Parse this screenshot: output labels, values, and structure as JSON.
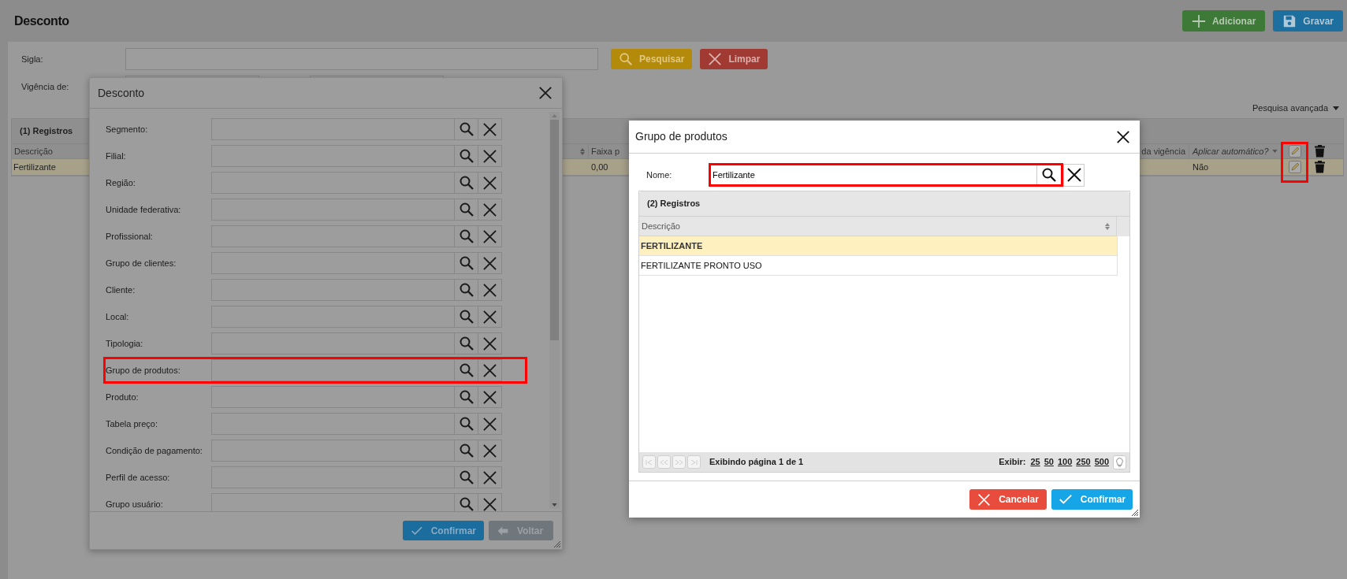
{
  "page": {
    "title": "Desconto",
    "buttons": [
      {
        "label": "Adicionar",
        "kind": "add"
      },
      {
        "label": "Gravar",
        "kind": "save"
      }
    ]
  },
  "filters": {
    "sigla_label": "Sigla:",
    "vigencia_label": "Vigência de:",
    "buttons": [
      {
        "label": "Pesquisar",
        "kind": "search"
      },
      {
        "label": "Limpar",
        "kind": "clear"
      }
    ],
    "advanced_search": "Pesquisa avançada"
  },
  "results": {
    "header": "(1) Registros",
    "columns": [
      "Descrição",
      "Faixa p",
      "da vigência",
      "Aplicar automático?"
    ],
    "edit_highlighted": true,
    "rows": [
      {
        "cells": [
          "Fertilizante",
          "0,00",
          "",
          "Não"
        ],
        "selected": true
      }
    ]
  },
  "filter_dialog": {
    "title": "Desconto",
    "fields": [
      {
        "label": "Segmento:",
        "highlighted": false
      },
      {
        "label": "Filial:",
        "highlighted": false
      },
      {
        "label": "Região:",
        "highlighted": false
      },
      {
        "label": "Unidade federativa:",
        "highlighted": false
      },
      {
        "label": "Profissional:",
        "highlighted": false
      },
      {
        "label": "Grupo de clientes:",
        "highlighted": false
      },
      {
        "label": "Cliente:",
        "highlighted": false
      },
      {
        "label": "Local:",
        "highlighted": false
      },
      {
        "label": "Tipologia:",
        "highlighted": false
      },
      {
        "label": "Grupo de produtos:",
        "highlighted": true
      },
      {
        "label": "Produto:",
        "highlighted": false
      },
      {
        "label": "Tabela preço:",
        "highlighted": false
      },
      {
        "label": "Condição de pagamento:",
        "highlighted": false
      },
      {
        "label": "Perfil de acesso:",
        "highlighted": false
      },
      {
        "label": "Grupo usuário:",
        "highlighted": false
      }
    ],
    "buttons": [
      {
        "label": "Confirmar",
        "kind": "confirm"
      },
      {
        "label": "Voltar",
        "kind": "back"
      }
    ]
  },
  "lookup_dialog": {
    "title": "Grupo de produtos",
    "search": {
      "label": "Nome:",
      "value": "Fertilizante",
      "highlighted": true
    },
    "header": "(2) Registros",
    "column": "Descrição",
    "rows": [
      {
        "text": "FERTILIZANTE",
        "selected": true
      },
      {
        "text": "FERTILIZANTE PRONTO USO",
        "selected": false
      }
    ],
    "pager": {
      "status": "Exibindo página 1 de 1",
      "show_label": "Exibir:",
      "sizes": [
        "25",
        "50",
        "100",
        "250",
        "500"
      ]
    },
    "buttons": [
      {
        "label": "Cancelar",
        "kind": "cancel"
      },
      {
        "label": "Confirmar",
        "kind": "confirm"
      }
    ]
  }
}
